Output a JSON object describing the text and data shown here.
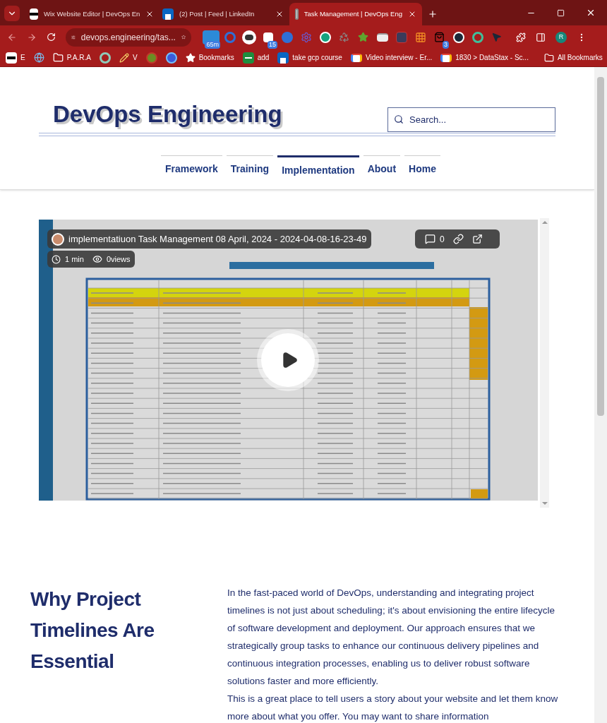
{
  "browser": {
    "tabs": [
      {
        "title": "Wix Website Editor | DevOps En",
        "kind": "wix",
        "selected": false
      },
      {
        "title": "(2) Post | Feed | LinkedIn",
        "kind": "linkedin",
        "selected": false
      },
      {
        "title": "Task Management | DevOps Eng",
        "kind": "page",
        "selected": true
      }
    ],
    "address": "devops.engineering/tas...",
    "extensions": [
      {
        "kind": "timer",
        "badge": "65m"
      },
      {
        "kind": "ring"
      },
      {
        "kind": "dots"
      },
      {
        "kind": "flag",
        "badge": "15"
      },
      {
        "kind": "meet"
      },
      {
        "kind": "gear"
      },
      {
        "kind": "grammar"
      },
      {
        "kind": "recycle"
      },
      {
        "kind": "star"
      },
      {
        "kind": "window"
      },
      {
        "kind": "board"
      },
      {
        "kind": "grid"
      },
      {
        "kind": "bag",
        "badge": "3"
      },
      {
        "kind": "steam"
      },
      {
        "kind": "swirl"
      },
      {
        "kind": "pointer"
      }
    ],
    "profile": "R",
    "bookmarks": [
      {
        "kind": "wix",
        "label": "E"
      },
      {
        "kind": "wordpress"
      },
      {
        "kind": "folder",
        "label": "P.A.R.A"
      },
      {
        "kind": "swirl"
      },
      {
        "kind": "pencil",
        "label": "V"
      },
      {
        "kind": "figure"
      },
      {
        "kind": "circle"
      },
      {
        "kind": "star",
        "label": "Bookmarks"
      },
      {
        "kind": "sheet",
        "label": "add"
      },
      {
        "kind": "linkedin",
        "label": "take gcp course"
      },
      {
        "kind": "gmail",
        "label": "Video interview - Er..."
      },
      {
        "kind": "gmail",
        "label": "1830 > DataStax - Sc..."
      }
    ],
    "all_bookmarks": "All Bookmarks"
  },
  "site": {
    "title": "DevOps Engineering",
    "search": {
      "placeholder": "Search..."
    },
    "nav": [
      {
        "label": "Framework",
        "selected": false
      },
      {
        "label": "Training",
        "selected": false
      },
      {
        "label": "Implementation",
        "selected": true
      },
      {
        "label": "About",
        "selected": false
      },
      {
        "label": "Home",
        "selected": false
      }
    ],
    "video": {
      "kind": "picture",
      "title": "implementatiuon Task Management 08 April, 2024 - 2024-04-08-16-23-49",
      "comments": "0",
      "duration": "1 min",
      "views": "0views"
    },
    "section": {
      "heading": "Why Project Timelines Are Essential",
      "paragraphs": [
        "In the fast-paced world of DevOps, understanding and integrating project timelines is not just about scheduling; it's about envisioning the entire lifecycle of software development and deployment. Our approach ensures that we strategically group tasks to enhance our continuous delivery pipelines and continuous integration processes, enabling us to deliver robust software solutions faster and more efficiently.",
        "This is a great place to tell users a story about your website and let them know more about what you offer. You may want to share information"
      ]
    }
  }
}
